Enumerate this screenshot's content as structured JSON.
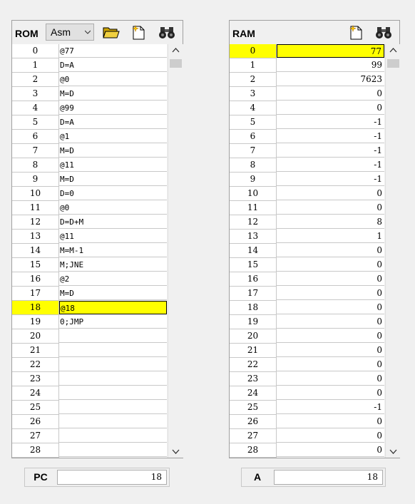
{
  "rom": {
    "title": "ROM",
    "mode": "Asm",
    "highlight_row": 18,
    "rows": [
      {
        "addr": "0",
        "val": "@77"
      },
      {
        "addr": "1",
        "val": "D=A"
      },
      {
        "addr": "2",
        "val": "@0"
      },
      {
        "addr": "3",
        "val": "M=D"
      },
      {
        "addr": "4",
        "val": "@99"
      },
      {
        "addr": "5",
        "val": "D=A"
      },
      {
        "addr": "6",
        "val": "@1"
      },
      {
        "addr": "7",
        "val": "M=D"
      },
      {
        "addr": "8",
        "val": "@11"
      },
      {
        "addr": "9",
        "val": "M=D"
      },
      {
        "addr": "10",
        "val": "D=0"
      },
      {
        "addr": "11",
        "val": "@0"
      },
      {
        "addr": "12",
        "val": "D=D+M"
      },
      {
        "addr": "13",
        "val": "@11"
      },
      {
        "addr": "14",
        "val": "M=M-1"
      },
      {
        "addr": "15",
        "val": "M;JNE"
      },
      {
        "addr": "16",
        "val": "@2"
      },
      {
        "addr": "17",
        "val": "M=D"
      },
      {
        "addr": "18",
        "val": "@18"
      },
      {
        "addr": "19",
        "val": "0;JMP"
      },
      {
        "addr": "20",
        "val": ""
      },
      {
        "addr": "21",
        "val": ""
      },
      {
        "addr": "22",
        "val": ""
      },
      {
        "addr": "23",
        "val": ""
      },
      {
        "addr": "24",
        "val": ""
      },
      {
        "addr": "25",
        "val": ""
      },
      {
        "addr": "26",
        "val": ""
      },
      {
        "addr": "27",
        "val": ""
      },
      {
        "addr": "28",
        "val": ""
      }
    ]
  },
  "ram": {
    "title": "RAM",
    "highlight_row": 0,
    "rows": [
      {
        "addr": "0",
        "val": "77"
      },
      {
        "addr": "1",
        "val": "99"
      },
      {
        "addr": "2",
        "val": "7623"
      },
      {
        "addr": "3",
        "val": "0"
      },
      {
        "addr": "4",
        "val": "0"
      },
      {
        "addr": "5",
        "val": "-1"
      },
      {
        "addr": "6",
        "val": "-1"
      },
      {
        "addr": "7",
        "val": "-1"
      },
      {
        "addr": "8",
        "val": "-1"
      },
      {
        "addr": "9",
        "val": "-1"
      },
      {
        "addr": "10",
        "val": "0"
      },
      {
        "addr": "11",
        "val": "0"
      },
      {
        "addr": "12",
        "val": "8"
      },
      {
        "addr": "13",
        "val": "1"
      },
      {
        "addr": "14",
        "val": "0"
      },
      {
        "addr": "15",
        "val": "0"
      },
      {
        "addr": "16",
        "val": "0"
      },
      {
        "addr": "17",
        "val": "0"
      },
      {
        "addr": "18",
        "val": "0"
      },
      {
        "addr": "19",
        "val": "0"
      },
      {
        "addr": "20",
        "val": "0"
      },
      {
        "addr": "21",
        "val": "0"
      },
      {
        "addr": "22",
        "val": "0"
      },
      {
        "addr": "23",
        "val": "0"
      },
      {
        "addr": "24",
        "val": "0"
      },
      {
        "addr": "25",
        "val": "-1"
      },
      {
        "addr": "26",
        "val": "0"
      },
      {
        "addr": "27",
        "val": "0"
      },
      {
        "addr": "28",
        "val": "0"
      }
    ]
  },
  "registers": {
    "pc": {
      "label": "PC",
      "value": "18"
    },
    "a": {
      "label": "A",
      "value": "18"
    }
  },
  "icons": {
    "open": "folder-open-icon",
    "new": "new-file-icon",
    "find": "binoculars-icon"
  },
  "colors": {
    "highlight": "#ffff00"
  }
}
